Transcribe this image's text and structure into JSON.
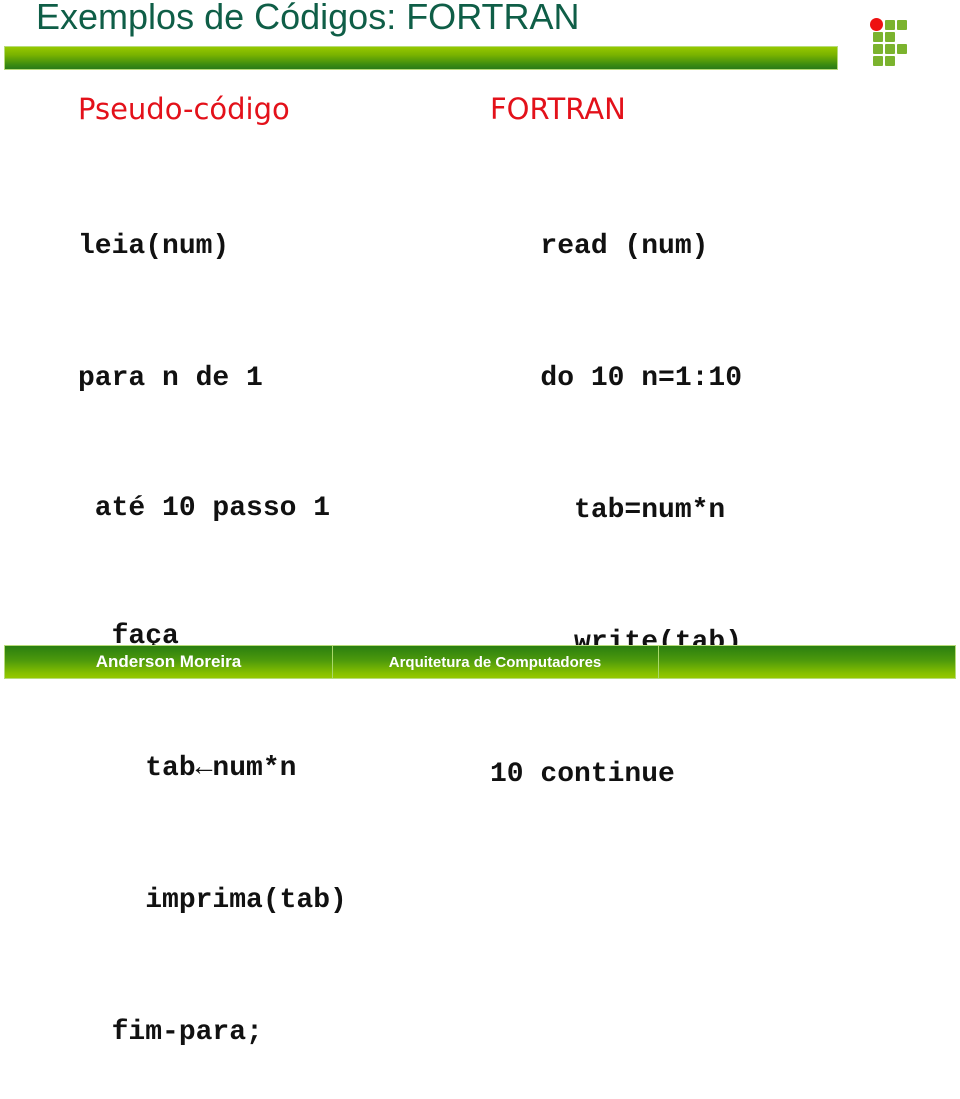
{
  "slide": {
    "title": "Exemplos de Códigos: FORTRAN"
  },
  "pseudo": {
    "heading": "Pseudo-código",
    "lines": [
      "leia(num)",
      "para n de 1",
      " até 10 passo 1",
      "  faça",
      "    tab←num*n",
      "    imprima(tab)",
      "  fim-para;"
    ]
  },
  "fortran": {
    "heading": "FORTRAN",
    "lines": [
      "   read (num)",
      "   do 10 n=1:10",
      "     tab=num*n",
      "     write(tab)",
      "10 continue"
    ]
  },
  "footer": {
    "author": "Anderson Moreira",
    "course": "Arquitetura de Computadores"
  },
  "colors": {
    "title": "#0f5e47",
    "heading": "#e3111a",
    "bar_green": "#7ab300",
    "logo_green": "#7bb32e",
    "logo_red": "#ee1111"
  }
}
